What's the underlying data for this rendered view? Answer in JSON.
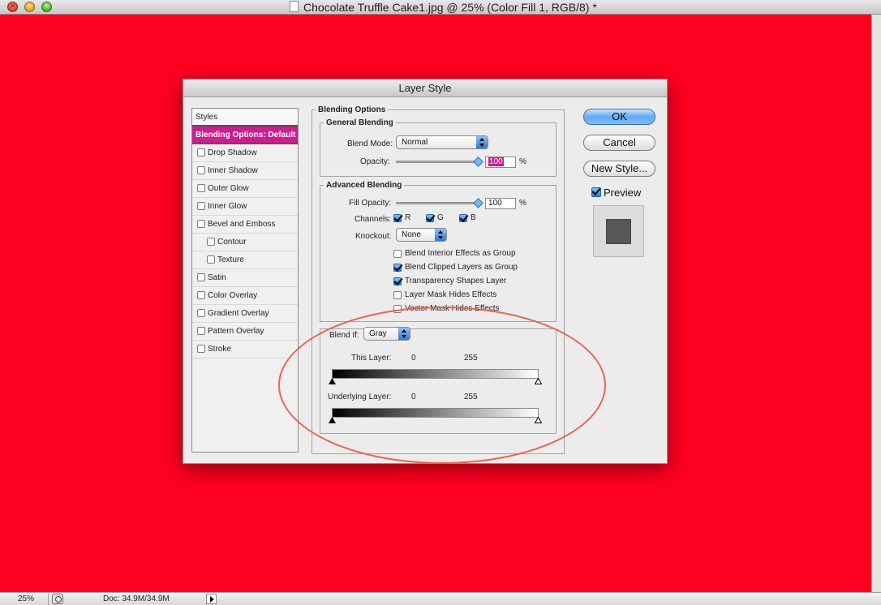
{
  "window": {
    "title": "Chocolate Truffle Cake1.jpg @ 25% (Color Fill 1, RGB/8) *"
  },
  "canvas": {
    "color": "#fe0020"
  },
  "statusbar": {
    "zoom": "25%",
    "doc": "Doc: 34.9M/34.9M"
  },
  "dialog": {
    "title": "Layer Style",
    "styles_header": "Styles",
    "styles": [
      {
        "label": "Blending Options: Default",
        "active": true,
        "checkbox": false
      },
      {
        "label": "Drop Shadow",
        "checked": false
      },
      {
        "label": "Inner Shadow",
        "checked": false
      },
      {
        "label": "Outer Glow",
        "checked": false
      },
      {
        "label": "Inner Glow",
        "checked": false
      },
      {
        "label": "Bevel and Emboss",
        "checked": false
      },
      {
        "label": "Contour",
        "checked": false,
        "indent": true
      },
      {
        "label": "Texture",
        "checked": false,
        "indent": true
      },
      {
        "label": "Satin",
        "checked": false
      },
      {
        "label": "Color Overlay",
        "checked": false
      },
      {
        "label": "Gradient Overlay",
        "checked": false
      },
      {
        "label": "Pattern Overlay",
        "checked": false
      },
      {
        "label": "Stroke",
        "checked": false
      }
    ],
    "blending_options": {
      "title": "Blending Options",
      "general": {
        "title": "General Blending",
        "blend_mode_label": "Blend Mode:",
        "blend_mode": "Normal",
        "opacity_label": "Opacity:",
        "opacity": "100",
        "percent": "%"
      },
      "advanced": {
        "title": "Advanced Blending",
        "fill_opacity_label": "Fill Opacity:",
        "fill_opacity": "100",
        "percent": "%",
        "channels_label": "Channels:",
        "channels": [
          {
            "label": "R",
            "checked": true
          },
          {
            "label": "G",
            "checked": true
          },
          {
            "label": "B",
            "checked": true
          }
        ],
        "knockout_label": "Knockout:",
        "knockout": "None",
        "options": [
          {
            "label": "Blend Interior Effects as Group",
            "checked": false
          },
          {
            "label": "Blend Clipped Layers as Group",
            "checked": true
          },
          {
            "label": "Transparency Shapes Layer",
            "checked": true
          },
          {
            "label": "Layer Mask Hides Effects",
            "checked": false
          },
          {
            "label": "Vector Mask Hides Effects",
            "checked": false
          }
        ]
      },
      "blend_if": {
        "label": "Blend If:",
        "value": "Gray",
        "this_layer_label": "This Layer:",
        "this_layer_min": "0",
        "this_layer_max": "255",
        "underlying_label": "Underlying Layer:",
        "underlying_min": "0",
        "underlying_max": "255"
      }
    },
    "buttons": {
      "ok": "OK",
      "cancel": "Cancel",
      "new_style": "New Style..."
    },
    "preview_label": "Preview",
    "preview_checked": true
  }
}
